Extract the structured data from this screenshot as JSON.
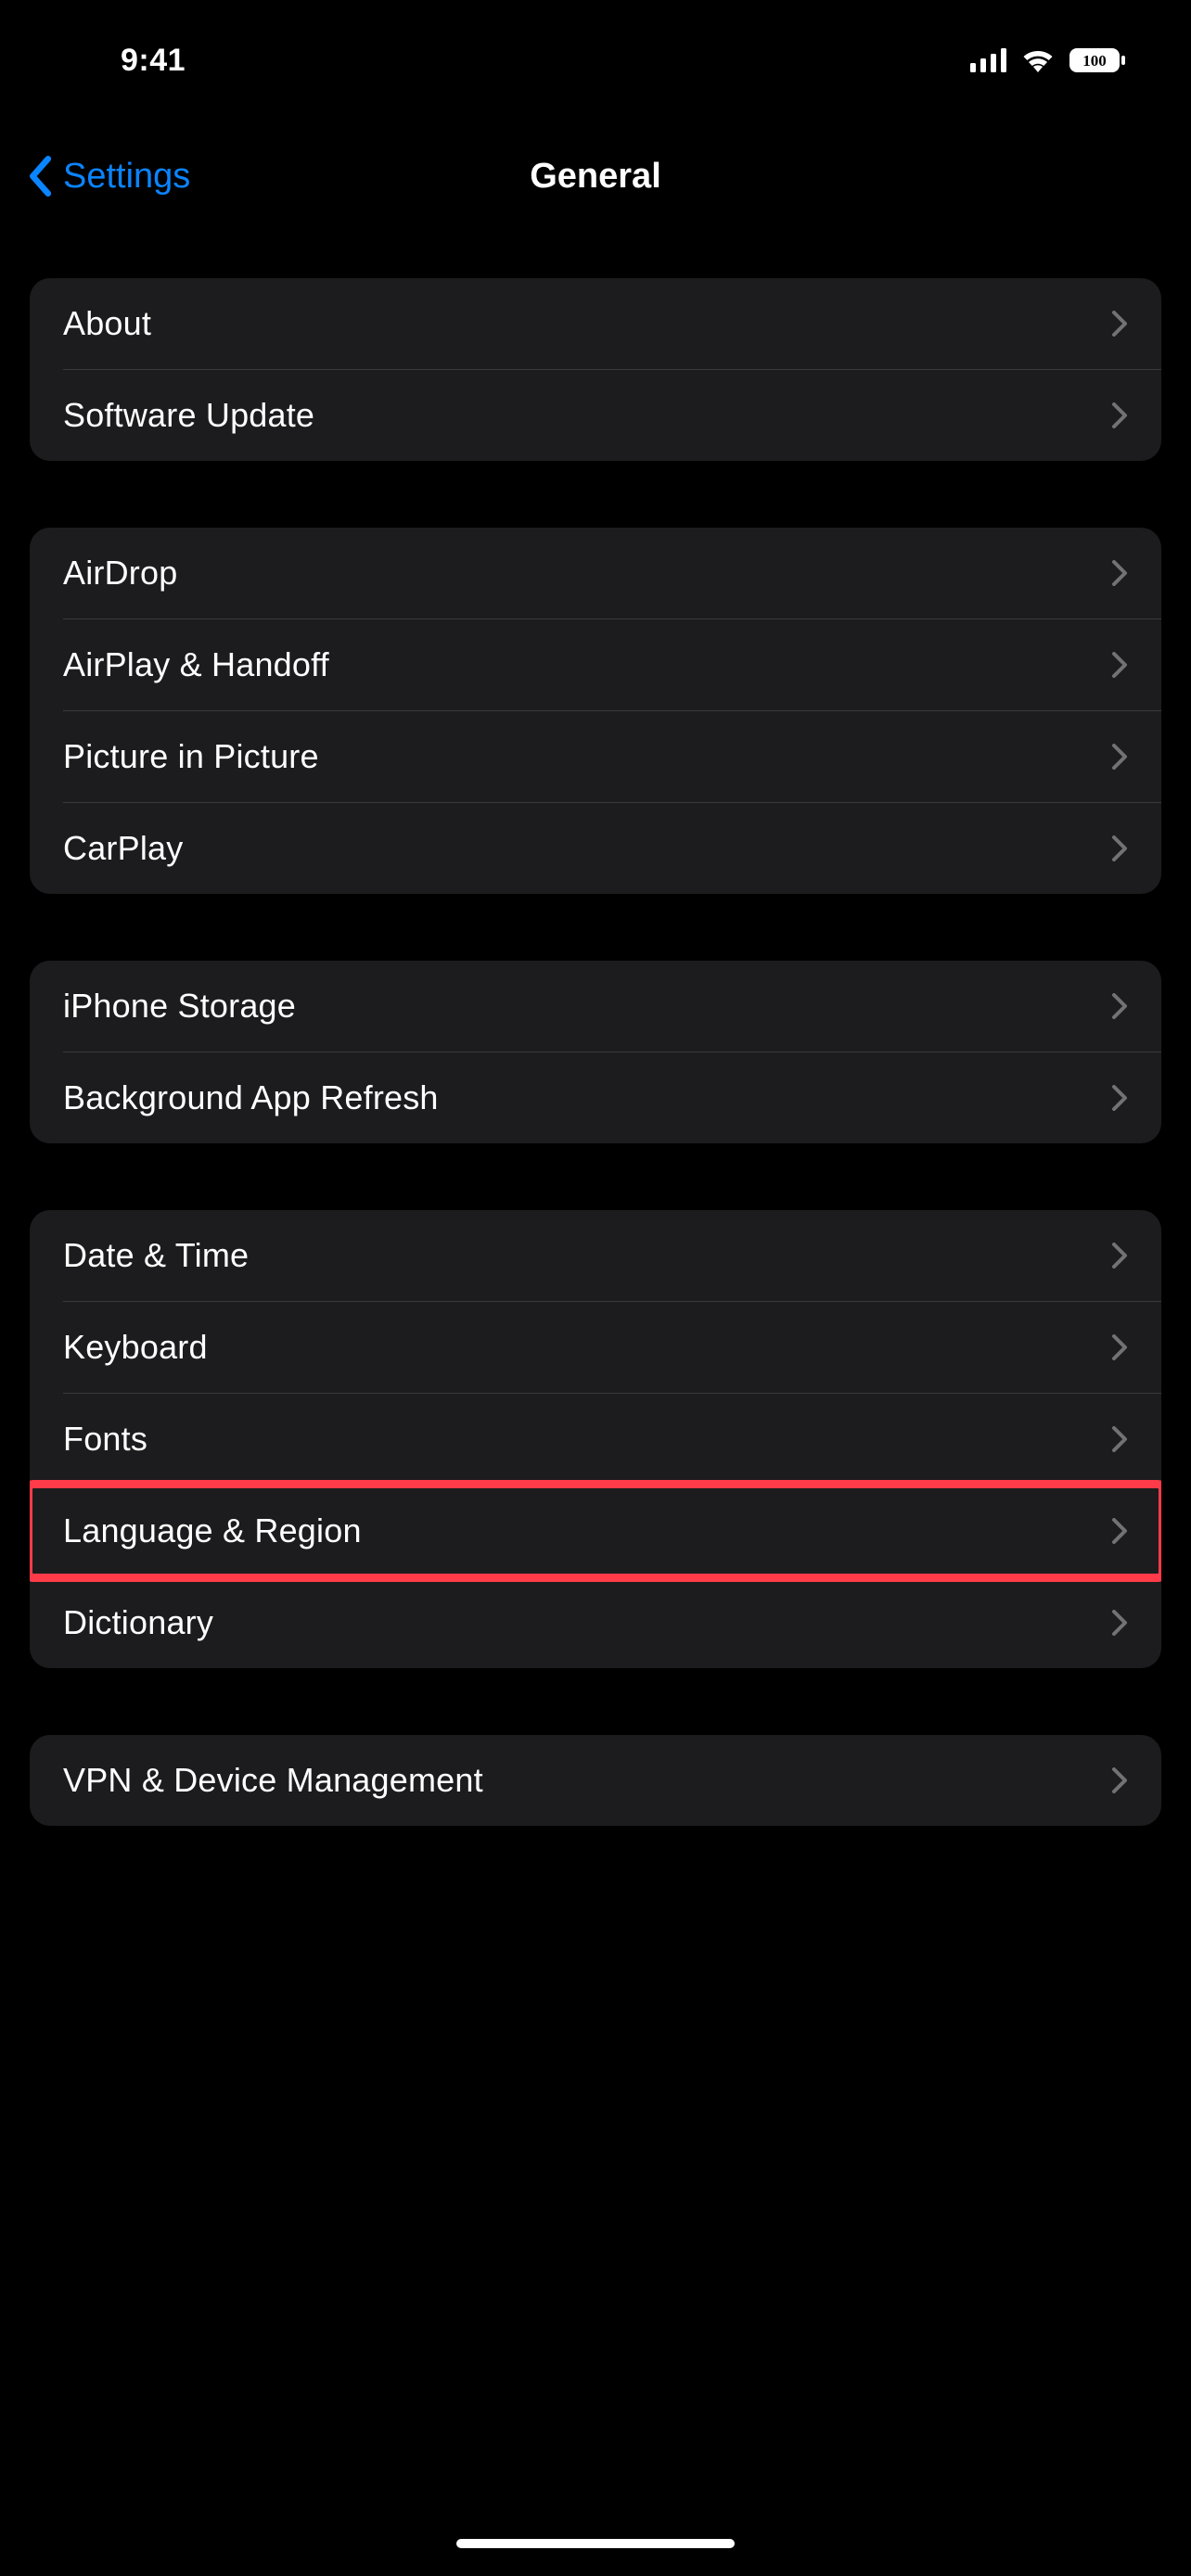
{
  "status": {
    "time": "9:41",
    "battery": "100"
  },
  "nav": {
    "back_label": "Settings",
    "title": "General"
  },
  "sections": [
    {
      "id": "info",
      "rows": [
        {
          "id": "about",
          "label": "About"
        },
        {
          "id": "software-update",
          "label": "Software Update"
        }
      ]
    },
    {
      "id": "connectivity",
      "rows": [
        {
          "id": "airdrop",
          "label": "AirDrop"
        },
        {
          "id": "airplay-handoff",
          "label": "AirPlay & Handoff"
        },
        {
          "id": "picture-in-picture",
          "label": "Picture in Picture"
        },
        {
          "id": "carplay",
          "label": "CarPlay"
        }
      ]
    },
    {
      "id": "storage",
      "rows": [
        {
          "id": "iphone-storage",
          "label": "iPhone Storage"
        },
        {
          "id": "background-app-refresh",
          "label": "Background App Refresh"
        }
      ]
    },
    {
      "id": "localization",
      "rows": [
        {
          "id": "date-time",
          "label": "Date & Time"
        },
        {
          "id": "keyboard",
          "label": "Keyboard"
        },
        {
          "id": "fonts",
          "label": "Fonts"
        },
        {
          "id": "language-region",
          "label": "Language & Region",
          "highlighted": true
        },
        {
          "id": "dictionary",
          "label": "Dictionary"
        }
      ]
    },
    {
      "id": "management",
      "rows": [
        {
          "id": "vpn-device-management",
          "label": "VPN & Device Management"
        }
      ]
    }
  ]
}
